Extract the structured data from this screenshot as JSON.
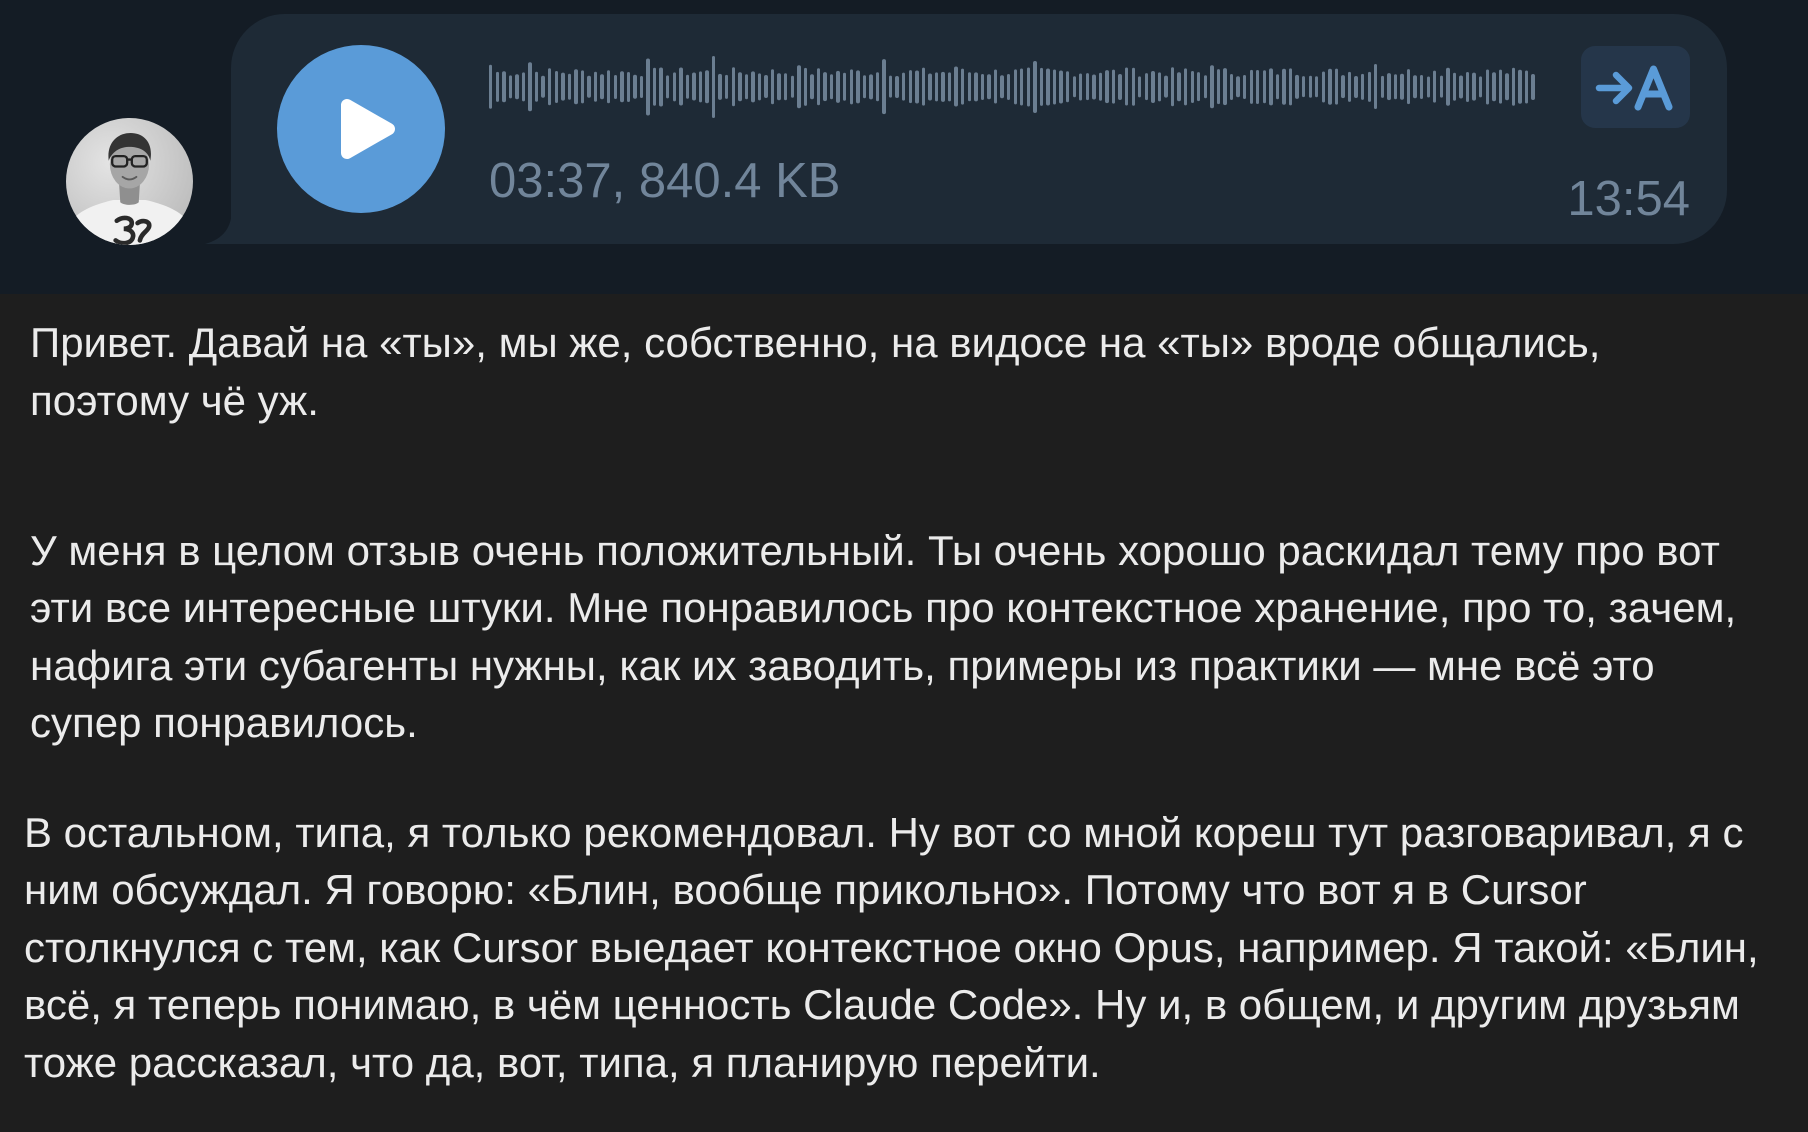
{
  "voice_message": {
    "duration_size": "03:37, 840.4 KB",
    "time": "13:54"
  },
  "icons": {
    "play": "play-icon",
    "transcribe": "speech-to-text-icon",
    "avatar": "avatar-photo"
  },
  "transcript": {
    "paragraphs": [
      {
        "lines": [
          "Привет. Давай на «ты», мы же, собственно, на видосе на «ты» вроде общались,",
          "поэтому чё уж."
        ]
      },
      {
        "lines": [
          "У меня в целом отзыв очень положительный. Ты очень хорошо раскидал тему про вот",
          "эти все интересные штуки. Мне понравилось про контекстное хранение, про то, зачем,",
          "нафига эти субагенты нужны, как их заводить, примеры из практики — мне всё это",
          "супер понравилось."
        ]
      },
      {
        "lines": [
          "В остальном, типа, я только рекомендовал. Ну вот со мной кореш тут разговаривал, я с",
          "ним обсуждал. Я говорю: «Блин, вообще прикольно». Потому что вот я в Cursor",
          "столкнулся с тем, как Cursor выедает контекстное окно Opus, например. Я такой: «Блин,",
          "всё, я теперь понимаю, в чём ценность Claude Code». Ну и, в общем, и другим друзьям",
          "тоже рассказал, что да, вот, типа, я планирую перейти."
        ]
      }
    ]
  },
  "colors": {
    "accent": "#5a9bd8",
    "header_bg": "#141c25",
    "bubble_bg": "#1e2a36",
    "button_bg": "#25364a",
    "panel_bg": "#1e1e1e",
    "text": "#ebebeb",
    "meta_text": "#71859a",
    "waveform": "#6b7e91"
  }
}
